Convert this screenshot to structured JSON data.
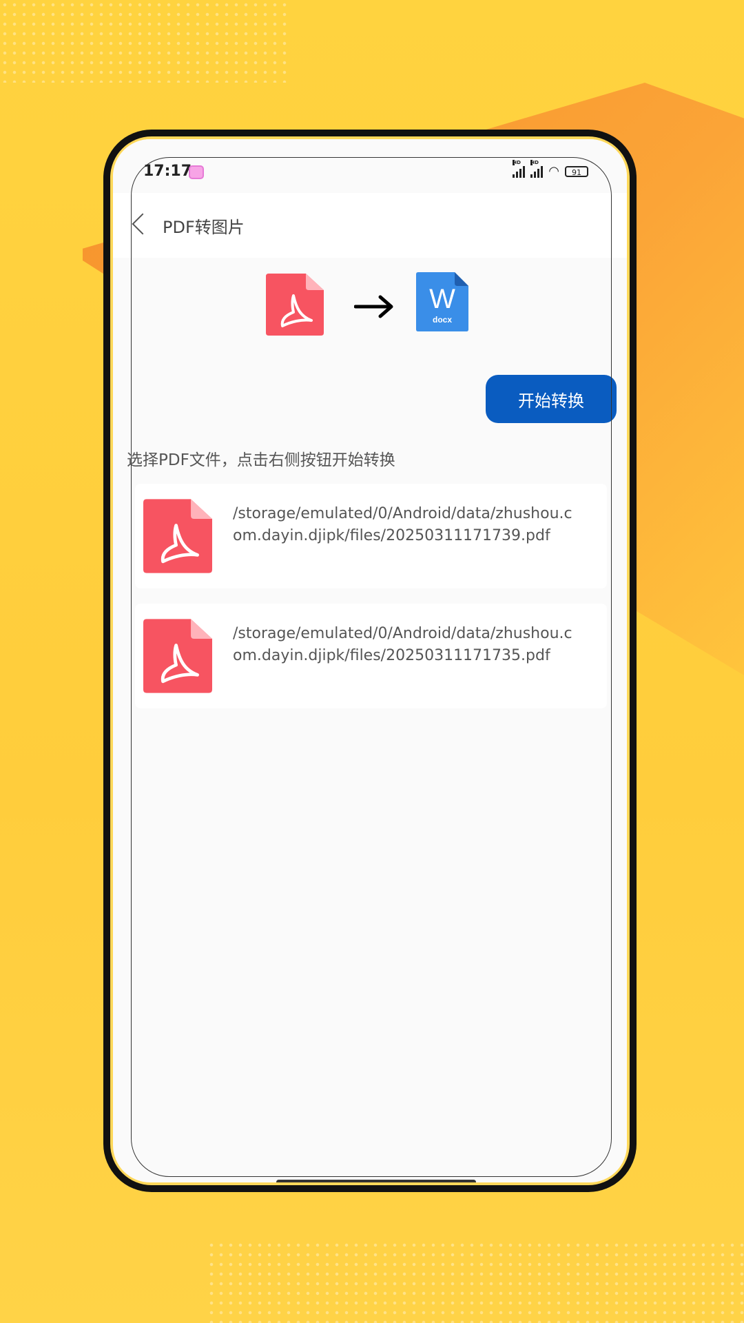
{
  "status_bar": {
    "time": "17:17",
    "hd1": "HD",
    "hd2": "HD",
    "battery": "91"
  },
  "nav": {
    "title": "PDF转图片"
  },
  "conversion": {
    "target_label": "docx",
    "target_letter": "W"
  },
  "action": {
    "start_label": "开始转换"
  },
  "hint": "选择PDF文件，点击右侧按钮开始转换",
  "files": [
    {
      "path": "/storage/emulated/0/Android/data/zhushou.com.dayin.djipk/files/20250311171739.pdf"
    },
    {
      "path": "/storage/emulated/0/Android/data/zhushou.com.dayin.djipk/files/20250311171735.pdf"
    }
  ],
  "colors": {
    "pdf_red": "#f75461",
    "word_blue": "#3a8ee8",
    "button_blue": "#0a5cc0",
    "background_yellow": "#ffd33f"
  }
}
